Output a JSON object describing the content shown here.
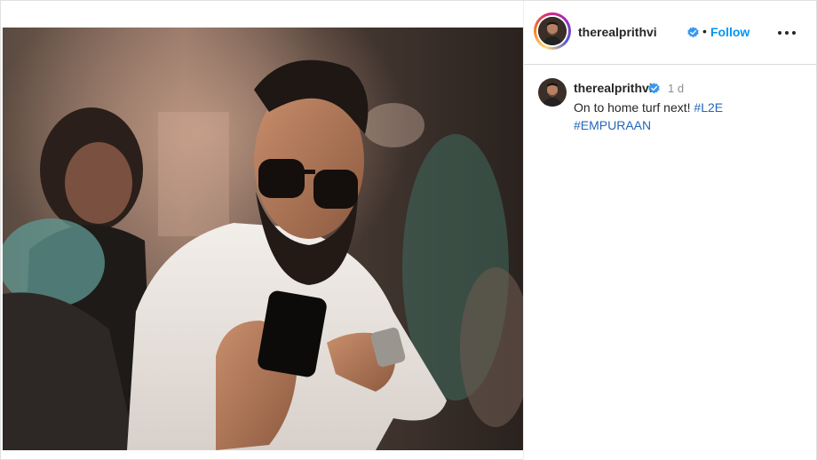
{
  "post": {
    "author": {
      "username": "therealprithvi",
      "verified": true,
      "avatar_icon": "profile-photo"
    },
    "header": {
      "separator": "•",
      "follow_label": "Follow",
      "more_icon": "more-horizontal-icon"
    },
    "caption": {
      "username": "therealprithvi",
      "time": "1 d",
      "text": "On to home turf next!",
      "hashtags": [
        "#L2E",
        "#EMPURAAN"
      ]
    }
  },
  "colors": {
    "link_blue": "#0095f6",
    "text": "#262626",
    "muted": "#8e8e8e",
    "verified_blue": "#3897f0"
  }
}
